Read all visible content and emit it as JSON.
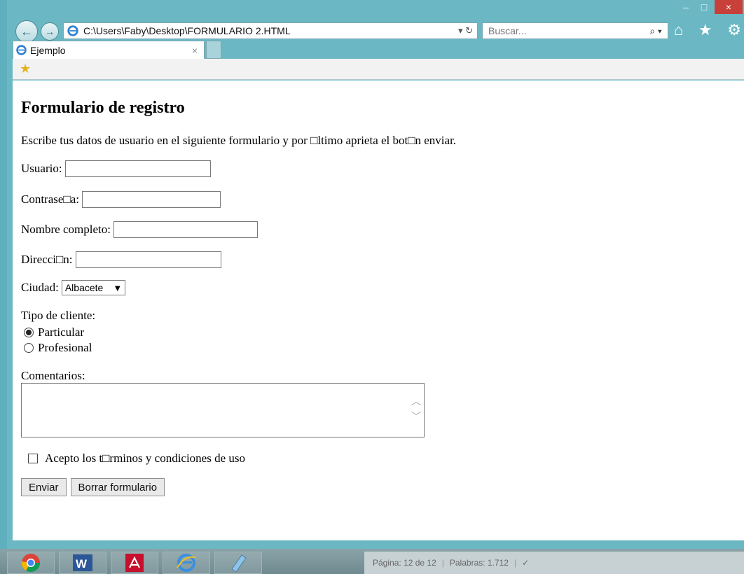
{
  "window": {
    "controls": {
      "minimize": "–",
      "maximize": "□",
      "close": "×"
    },
    "address_url": "C:\\Users\\Faby\\Desktop\\FORMULARIO 2.HTML",
    "address_tools": "▾ ↻",
    "search_placeholder": "Buscar...",
    "search_icon": "⌕ ▾",
    "icons": {
      "home": "⌂",
      "favorites": "★",
      "settings": "⚙"
    }
  },
  "tab": {
    "title": "Ejemplo",
    "close": "×"
  },
  "favorites_bar": {
    "star": "★"
  },
  "form": {
    "heading": "Formulario de registro",
    "intro": "Escribe tus datos de usuario en el siguiente formulario y por □ltimo aprieta el bot□n enviar.",
    "usuario_label": "Usuario:",
    "password_label": "Contrase□a:",
    "nombre_label": "Nombre completo:",
    "direccion_label": "Direcci□n:",
    "ciudad_label": "Ciudad:",
    "ciudad_value": "Albacete",
    "tipo_label": "Tipo de cliente:",
    "tipo_options": [
      "Particular",
      "Profesional"
    ],
    "tipo_selected": "Particular",
    "comentarios_label": "Comentarios:",
    "terminos_label": "Acepto los t□rminos y condiciones de uso",
    "enviar_button": "Enviar",
    "borrar_button": "Borrar formulario"
  },
  "statusbar": {
    "page": "Página: 12 de 12",
    "words": "Palabras: 1.712"
  },
  "colors": {
    "frame": "#6bb8c4",
    "close": "#c7403a"
  }
}
